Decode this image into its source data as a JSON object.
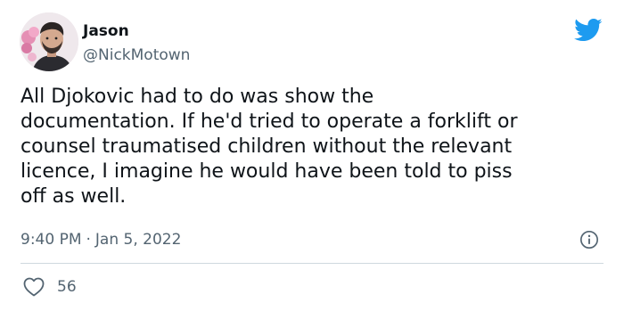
{
  "author": {
    "display_name": "Jason",
    "handle": "@NickMotown",
    "avatar_icon": "profile-photo"
  },
  "tweet": {
    "text": "All Djokovic had to do was show the\ndocumentation. If he'd tried to operate a forklift or\ncounsel traumatised children without the relevant\nlicence, I imagine he would have been told to piss\noff as well.",
    "time": "9:40 PM",
    "separator": "·",
    "date": "Jan 5, 2022"
  },
  "engagement": {
    "likes": "56",
    "like_icon": "heart-icon"
  },
  "icons": {
    "brand": "twitter-bird-icon",
    "info": "info-icon"
  },
  "colors": {
    "brand_blue": "#1d9bf0",
    "text_primary": "#0f1419",
    "text_secondary": "#536471",
    "divider": "#cfd9de"
  }
}
